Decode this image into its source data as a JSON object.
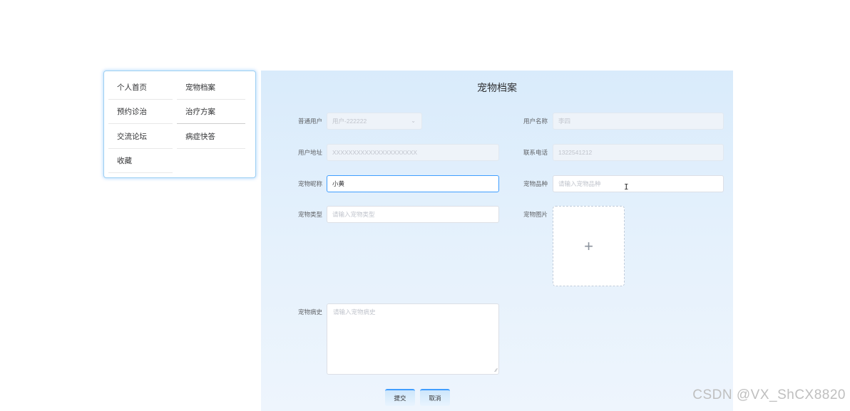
{
  "menu": {
    "items": [
      {
        "label": "个人首页"
      },
      {
        "label": "宠物档案"
      },
      {
        "label": "预约诊治"
      },
      {
        "label": "治疗方案"
      },
      {
        "label": "交流论坛"
      },
      {
        "label": "病症快答"
      },
      {
        "label": "收藏"
      }
    ]
  },
  "form": {
    "title": "宠物档案",
    "user_type": {
      "label": "普通用户",
      "value": "用户-222222"
    },
    "user_name": {
      "label": "用户名称",
      "value": "李四"
    },
    "address": {
      "label": "用户地址",
      "value": "XXXXXXXXXXXXXXXXXXXXX"
    },
    "phone": {
      "label": "联系电话",
      "value": "1322541212"
    },
    "pet_nickname": {
      "label": "宠物昵称",
      "value": "小黄"
    },
    "pet_breed": {
      "label": "宠物品种",
      "placeholder": "请输入宠物品种"
    },
    "pet_type": {
      "label": "宠物类型",
      "placeholder": "请输入宠物类型"
    },
    "pet_image": {
      "label": "宠物图片",
      "upload_icon": "plus-icon"
    },
    "pet_history": {
      "label": "宠物病史",
      "placeholder": "请输入宠物病史"
    },
    "submit_label": "提交",
    "cancel_label": "取消"
  },
  "watermark": "CSDN @VX_ShCX8820",
  "colors": {
    "accent": "#409eff",
    "panel_bg": "#e3f0fc",
    "menu_border": "#9fd0f2"
  }
}
